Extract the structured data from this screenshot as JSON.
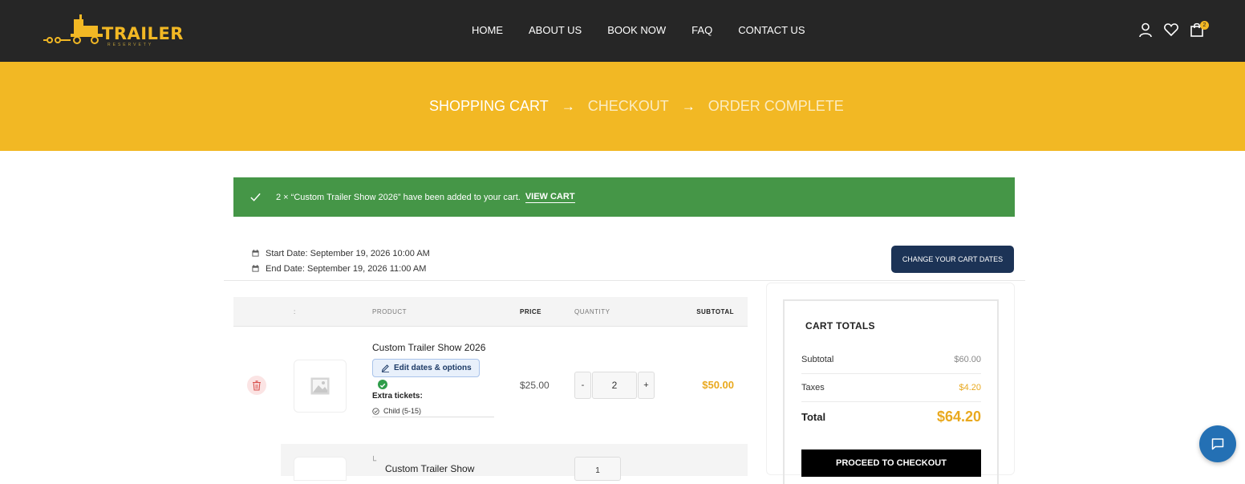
{
  "brand": {
    "name": "TRAILER",
    "tagline": "RESERVETY",
    "accent": "#f2b824",
    "dark": "#262626"
  },
  "nav": {
    "items": [
      "HOME",
      "ABOUT US",
      "BOOK NOW",
      "FAQ",
      "CONTACT US"
    ]
  },
  "header_icons": {
    "account": "user-icon",
    "wishlist": "heart-icon",
    "cart": "shopping-bag-icon",
    "cart_count": "2"
  },
  "steps": {
    "s1": "SHOPPING CART",
    "s2": "CHECKOUT",
    "s3": "ORDER COMPLETE",
    "separator": "→"
  },
  "notice": {
    "text": "2 × “Custom Trailer Show 2026” have been added to your cart.",
    "link": "VIEW CART",
    "color": "#459647"
  },
  "dates": {
    "start": "Start Date: September 19, 2026 10:00 AM",
    "end": "End Date: September 19, 2026 11:00 AM",
    "change_button": "CHANGE YOUR CART DATES"
  },
  "table": {
    "headers": {
      "col2": ":",
      "product": "PRODUCT",
      "price": "PRICE",
      "quantity": "QUANTITY",
      "subtotal": "SUBTOTAL"
    },
    "rows": [
      {
        "product": "Custom Trailer Show 2026",
        "edit_label": "Edit dates & options",
        "extra_label": "Extra tickets:",
        "extra_item": "Child (5-15)",
        "price": "$25.00",
        "qty_minus": "-",
        "qty_plus": "+",
        "quantity": "2",
        "subtotal": "$50.00"
      },
      {
        "mark": "└",
        "product": "Custom Trailer Show",
        "quantity": "1"
      }
    ]
  },
  "totals": {
    "title": "CART TOTALS",
    "subtotal_label": "Subtotal",
    "subtotal": "$60.00",
    "taxes_label": "Taxes",
    "taxes": "$4.20",
    "total_label": "Total",
    "total": "$64.20",
    "proceed": "PROCEED TO CHECKOUT"
  }
}
